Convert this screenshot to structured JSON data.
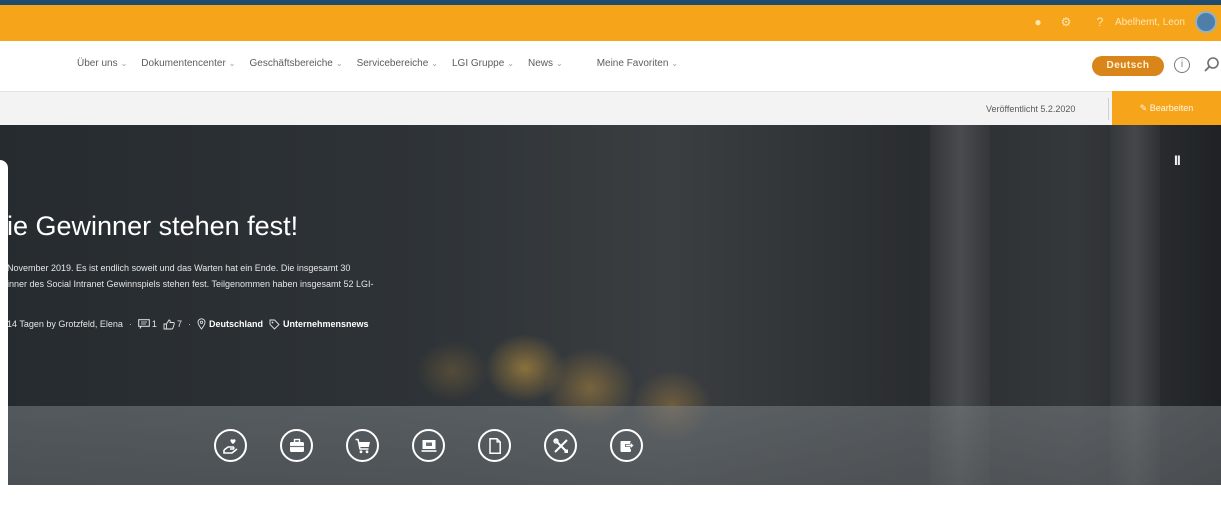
{
  "suitebar": {
    "username": "Abelhemt, Leon",
    "icons": [
      "bell-icon",
      "gear-icon",
      "help-icon"
    ]
  },
  "nav": {
    "items": [
      {
        "label": "Über uns"
      },
      {
        "label": "Dokumentencenter"
      },
      {
        "label": "Geschäftsbereiche"
      },
      {
        "label": "Servicebereiche"
      },
      {
        "label": "LGI Gruppe"
      },
      {
        "label": "News"
      },
      {
        "label": "Meine Favoriten"
      }
    ],
    "language": "Deutsch"
  },
  "commandbar": {
    "published": "Veröffentlicht 5.2.2020",
    "edit_label": "Bearbeiten"
  },
  "hero": {
    "pause_symbol": "II",
    "headline": "ie Gewinner stehen fest!",
    "excerpt_line1": "November 2019. Es ist endlich soweit und das Warten hat ein Ende. Die insgesamt 30",
    "excerpt_line2": "inner des Social Intranet Gewinnspiels stehen fest. Teilgenommen haben insgesamt 52 LGI-",
    "meta": {
      "author_text": "14 Tagen by Grotzfeld, Elena",
      "comments": "1",
      "likes": "7",
      "location": "Deutschland",
      "category": "Unternehmensnews"
    },
    "quicklinks": [
      "hand-heart-icon",
      "briefcase-icon",
      "cart-icon",
      "presentation-icon",
      "document-icon",
      "tools-icon",
      "share-icon"
    ]
  },
  "colors": {
    "suitebar": "#f6a51a",
    "topline": "#1e4a6e",
    "language_pill": "#d9851a"
  }
}
